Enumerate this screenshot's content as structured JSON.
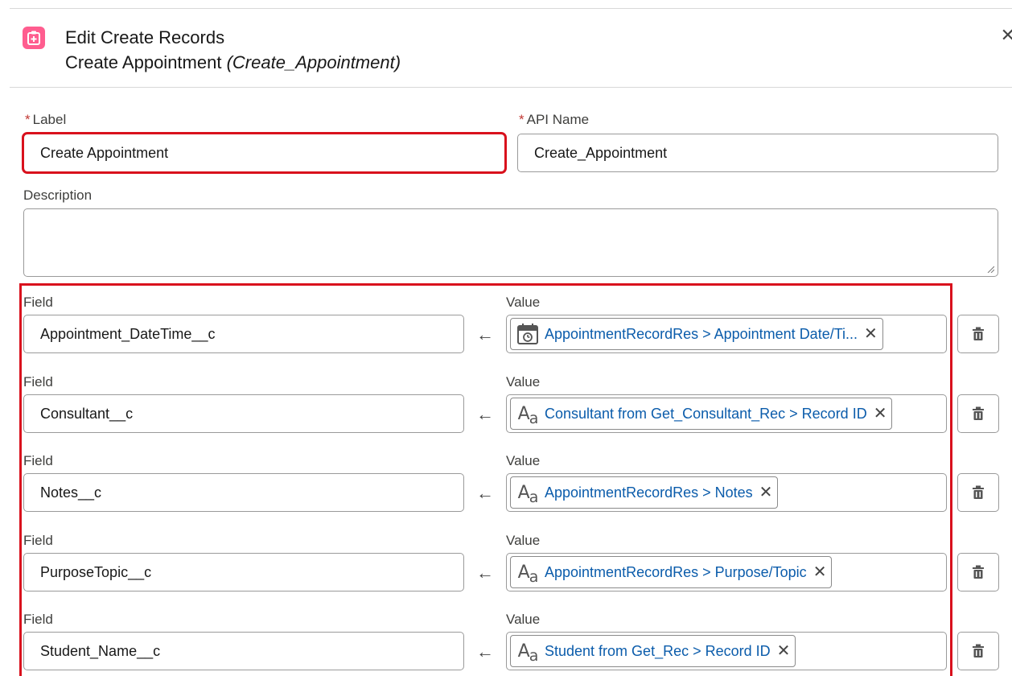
{
  "header": {
    "title": "Edit Create Records",
    "element_label": "Create Appointment",
    "element_api": "(Create_Appointment)"
  },
  "form": {
    "label": {
      "caption": "Label",
      "required_mark": "*",
      "value": "Create Appointment"
    },
    "api_name": {
      "caption": "API Name",
      "required_mark": "*",
      "value": "Create_Appointment"
    },
    "description": {
      "caption": "Description",
      "value": ""
    }
  },
  "mappings": [
    {
      "field_caption": "Field",
      "field": "Appointment_DateTime__c",
      "value_caption": "Value",
      "value_icon": "calendar-time-icon",
      "value": "AppointmentRecordRes > Appointment Date/Ti..."
    },
    {
      "field_caption": "Field",
      "field": "Consultant__c",
      "value_caption": "Value",
      "value_icon": "text-type-icon",
      "value": "Consultant from Get_Consultant_Rec > Record ID"
    },
    {
      "field_caption": "Field",
      "field": "Notes__c",
      "value_caption": "Value",
      "value_icon": "text-type-icon",
      "value": "AppointmentRecordRes > Notes"
    },
    {
      "field_caption": "Field",
      "field": "PurposeTopic__c",
      "value_caption": "Value",
      "value_icon": "text-type-icon",
      "value": "AppointmentRecordRes > Purpose/Topic"
    },
    {
      "field_caption": "Field",
      "field": "Student_Name__c",
      "value_caption": "Value",
      "value_icon": "text-type-icon",
      "value": "Student from Get_Rec > Record ID"
    }
  ],
  "icons": {
    "header": "create-records-icon",
    "close": "close-icon",
    "arrow": "arrow-left-icon",
    "delete": "trash-icon"
  },
  "colors": {
    "accent_pink": "#ff5d8f",
    "highlight_red": "#d9111d",
    "link_blue": "#0b5cab",
    "required_red": "#c23934"
  }
}
